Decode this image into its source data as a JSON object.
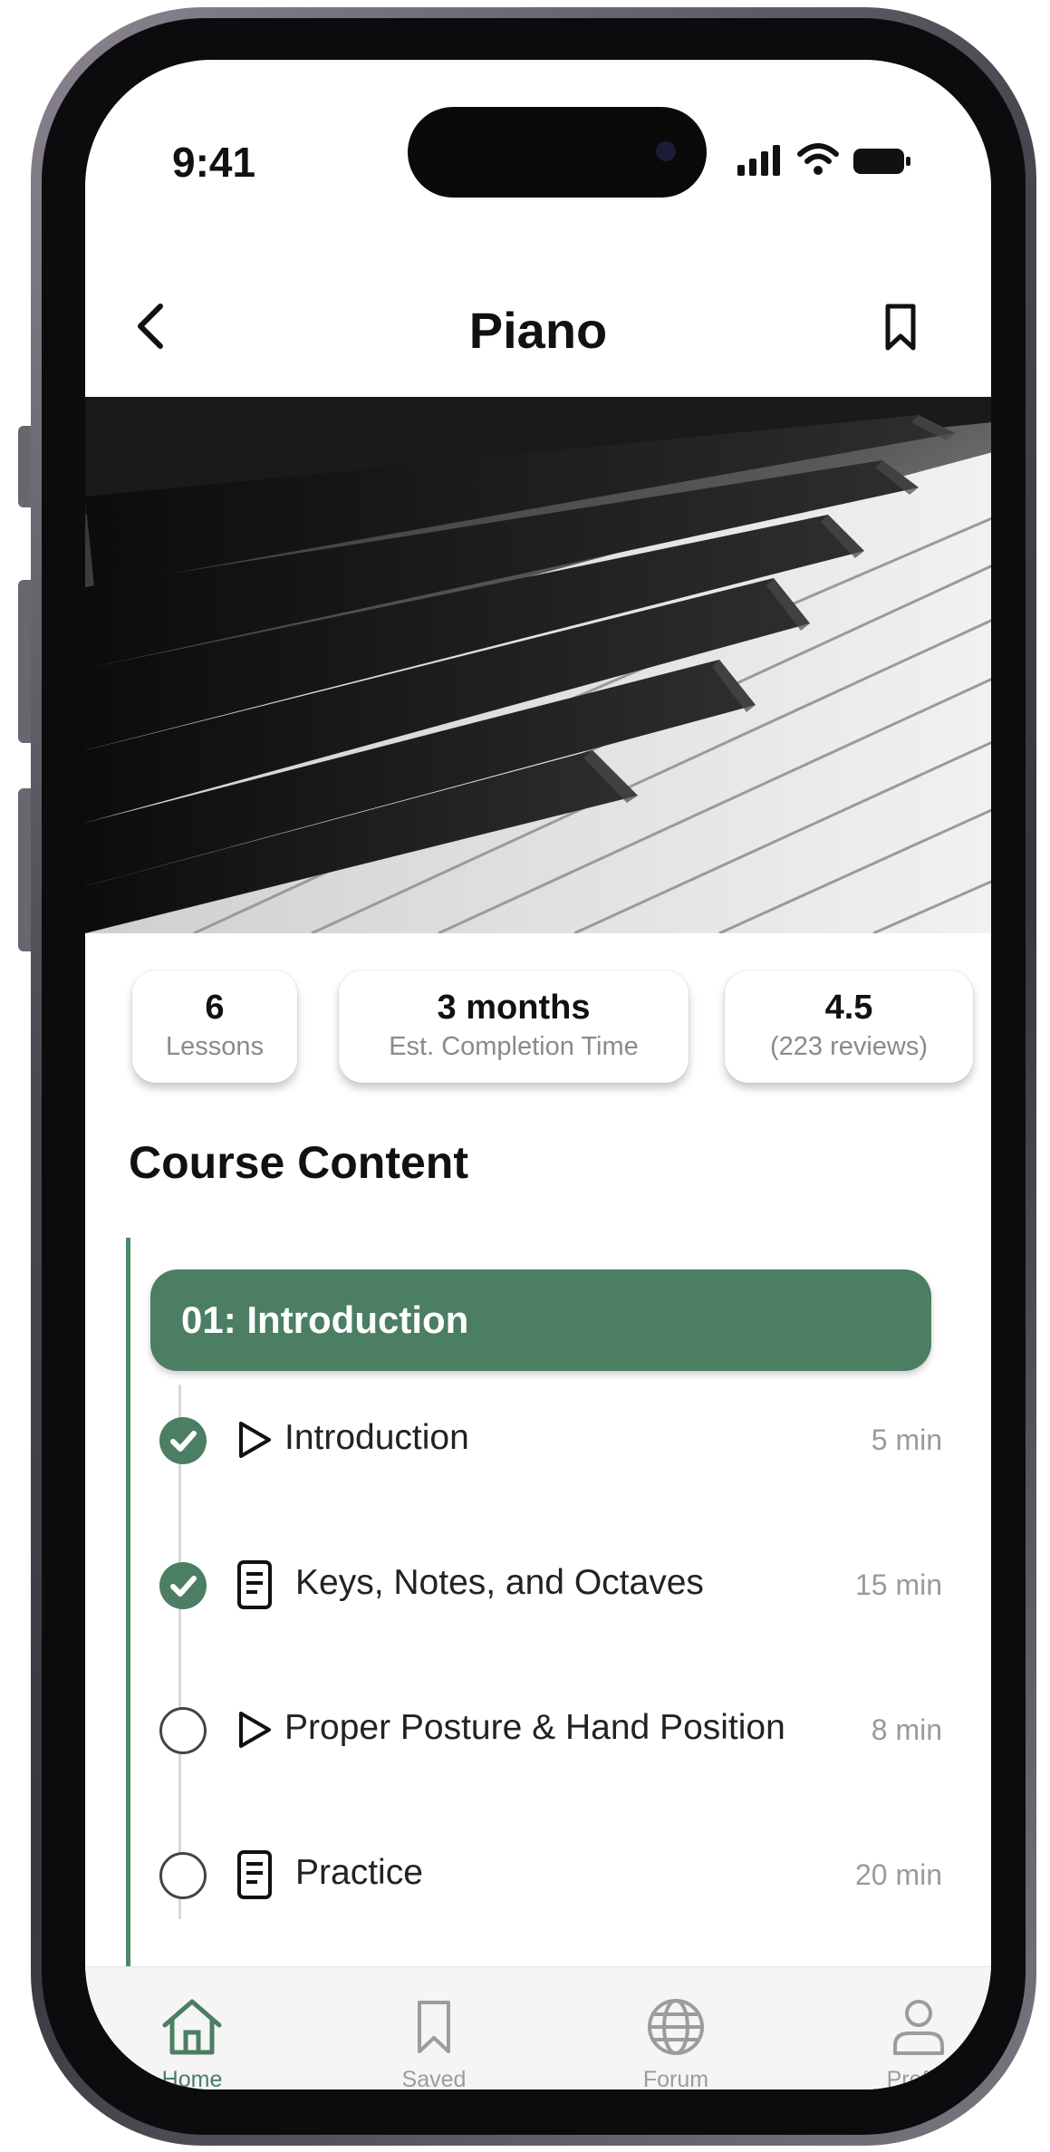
{
  "status_bar": {
    "time": "9:41"
  },
  "header": {
    "title": "Piano"
  },
  "stats": [
    {
      "value": "6",
      "label": "Lessons"
    },
    {
      "value": "3 months",
      "label": "Est. Completion Time"
    },
    {
      "value": "4.5",
      "label": "(223 reviews)"
    }
  ],
  "course": {
    "section_title": "Course Content",
    "module_title": "01: Introduction",
    "lessons": [
      {
        "name": "Introduction",
        "duration": "5 min",
        "type": "play-icon",
        "completed": true
      },
      {
        "name": "Keys, Notes, and Octaves",
        "duration": "15 min",
        "type": "document-icon",
        "completed": true
      },
      {
        "name": "Proper Posture & Hand Position",
        "duration": "8 min",
        "type": "play-icon",
        "completed": false
      },
      {
        "name": "Practice",
        "duration": "20 min",
        "type": "document-icon",
        "completed": false
      }
    ]
  },
  "tabs": [
    {
      "label": "Home",
      "icon": "home-icon",
      "active": true
    },
    {
      "label": "Saved",
      "icon": "bookmark-icon",
      "active": false
    },
    {
      "label": "Forum",
      "icon": "globe-icon",
      "active": false
    },
    {
      "label": "Profile",
      "icon": "person-icon",
      "active": false
    }
  ],
  "colors": {
    "accent": "#4b7e63",
    "rail": "#4a8a67"
  }
}
